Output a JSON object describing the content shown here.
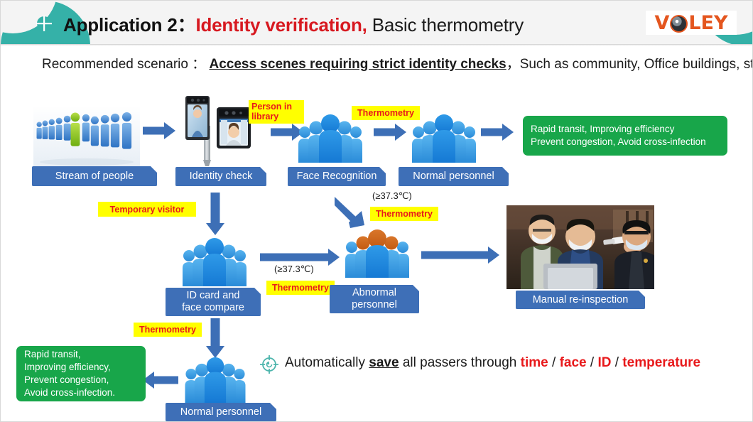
{
  "header": {
    "title_main": "Application 2",
    "title_colon": "：",
    "title_red": "Identity verification,",
    "title_plain": " Basic thermometry",
    "logo_before": "V",
    "logo_icon": "camera-lens-icon",
    "logo_after": "LEY",
    "corner_icon": "quadrant-circle-icon"
  },
  "scenario": {
    "lead": "Recommended scenario ：",
    "underlined": "Access scenes requiring strict identity checks",
    "tail": "，Such as community, Office buildings, station etc."
  },
  "flow": {
    "row1": {
      "crowd_photo": "crowd-of-blue-figures-photo",
      "label_stream": "Stream of people",
      "device_photo": "face-recognition-terminal-photo",
      "label_identity": "Identity check",
      "hl_person_in_library": "Person in\nlibrary",
      "label_face_recognition": "Face Recognition",
      "hl_thermometry_1": "Thermometry",
      "label_normal_personnel": "Normal personnel",
      "green_note": "Rapid transit, Improving efficiency\nPrevent congestion, Avoid cross-infection"
    },
    "row2": {
      "hl_temporary_visitor": "Temporary visitor",
      "label_id_card": "ID card and\nface compare",
      "temp_note_1": "(≥37.3℃)",
      "hl_thermometry_2": "Thermometry",
      "temp_note_2": "(≥37.3℃)",
      "hl_thermometry_3": "Thermometry",
      "label_abnormal": "Abnormal\npersonnel",
      "inspection_photo": "manual-temperature-check-photo",
      "label_manual": "Manual re-inspection"
    },
    "row3": {
      "hl_thermometry_4": "Thermometry",
      "label_normal_personnel_2": "Normal personnel",
      "green_note_2": "Rapid transit,\nImproving efficiency,\nPrevent congestion,\nAvoid cross-infection."
    }
  },
  "footer": {
    "target_icon": "target-crosshair-icon",
    "text_1": "Automatically ",
    "save_word": "save",
    "text_2": " all passers through ",
    "red_1": "time",
    "sep_1": " / ",
    "red_2": "face",
    "sep_2": " / ",
    "red_3": "ID",
    "sep_3": " / ",
    "red_4": "temperature"
  },
  "colors": {
    "teal": "#35b1a8",
    "brand_orange": "#e4561f",
    "red": "#d71920",
    "box_blue": "#3e6fb7",
    "arrow_blue": "#3d6fb6",
    "green": "#18a64a",
    "highlight_yellow": "#ffff00"
  }
}
